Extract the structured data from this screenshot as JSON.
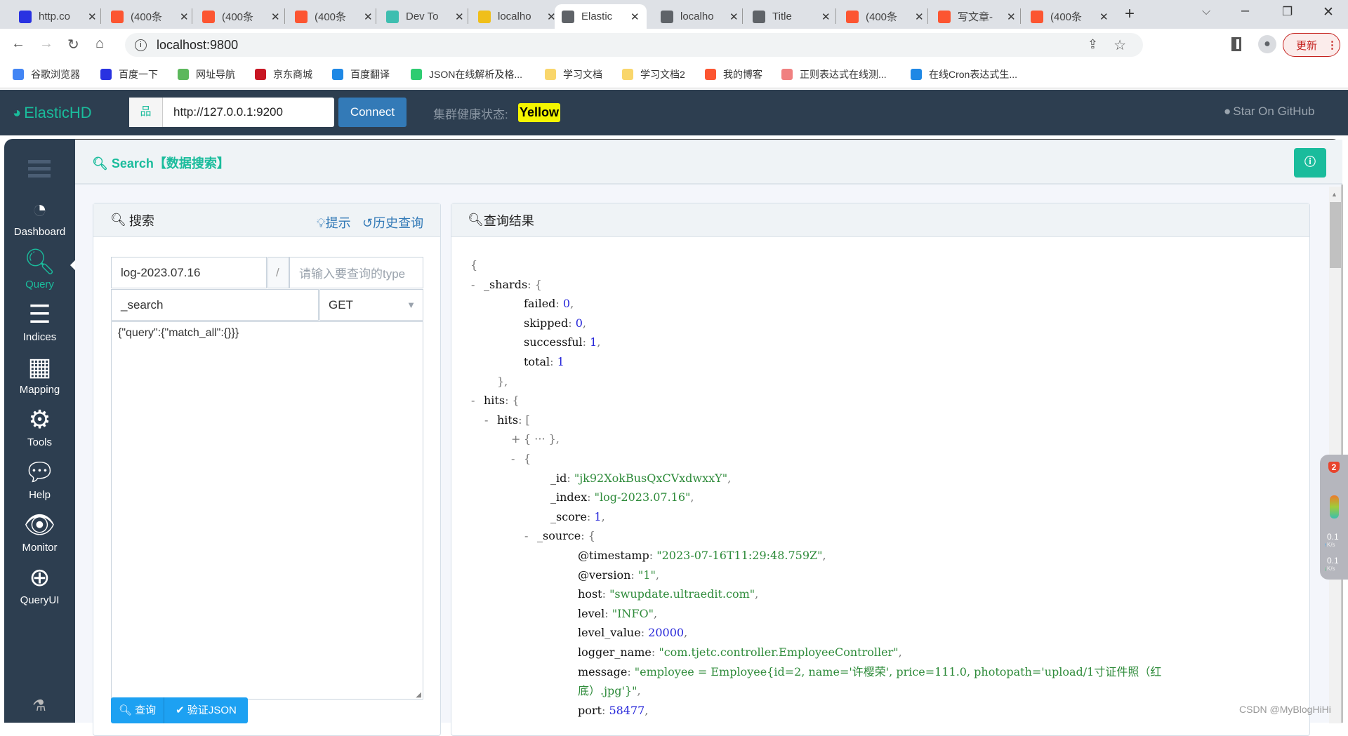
{
  "browser": {
    "tabs": [
      {
        "title": "http.co",
        "icon": "baidu-icon",
        "color": "#2932e1"
      },
      {
        "title": "(400条",
        "icon": "csdn-icon",
        "color": "#fc5531"
      },
      {
        "title": "(400条",
        "icon": "csdn-icon",
        "color": "#fc5531"
      },
      {
        "title": "(400条",
        "icon": "csdn-icon",
        "color": "#fc5531"
      },
      {
        "title": "Dev To",
        "icon": "elastic-devtools-icon",
        "color": "#3ebeb0"
      },
      {
        "title": "localho",
        "icon": "elastic-icon",
        "color": "#f0bf1a"
      },
      {
        "title": "Elastic",
        "icon": "globe-icon",
        "color": "#5f6368",
        "active": true
      },
      {
        "title": "localho",
        "icon": "globe-icon",
        "color": "#5f6368"
      },
      {
        "title": "Title",
        "icon": "globe-icon",
        "color": "#5f6368"
      },
      {
        "title": "(400条",
        "icon": "csdn-icon",
        "color": "#fc5531"
      },
      {
        "title": "写文章-",
        "icon": "csdn-icon",
        "color": "#fc5531"
      },
      {
        "title": "(400条",
        "icon": "csdn-icon",
        "color": "#fc5531"
      }
    ],
    "url": "localhost:9800",
    "update_label": "更新",
    "bookmarks": [
      {
        "label": "谷歌浏览器",
        "color": "#4285f4"
      },
      {
        "label": "百度一下",
        "color": "#2932e1"
      },
      {
        "label": "网址导航",
        "color": "#5cb85c"
      },
      {
        "label": "京东商城",
        "color": "#c81623"
      },
      {
        "label": "百度翻译",
        "color": "#1e88e5"
      },
      {
        "label": "JSON在线解析及格...",
        "color": "#2ecc71"
      },
      {
        "label": "学习文档",
        "color": "#f9d66b"
      },
      {
        "label": "学习文档2",
        "color": "#f9d66b"
      },
      {
        "label": "我的博客",
        "color": "#fc5531"
      },
      {
        "label": "正则表达式在线测...",
        "color": "#f08080"
      },
      {
        "label": "在线Cron表达式生...",
        "color": "#1e88e5"
      }
    ]
  },
  "app": {
    "brand": "ElasticHD",
    "server_url": "http://127.0.0.1:9200",
    "connect_label": "Connect",
    "health_label": "集群健康状态:",
    "health_value": "Yellow",
    "health_color": "#f5f500",
    "github_label": "Star On GitHub",
    "accent": "#1abc9c"
  },
  "sidebar": {
    "items": [
      {
        "label": "Dashboard",
        "icon": "dashboard-icon"
      },
      {
        "label": "Query",
        "icon": "search-icon",
        "active": true
      },
      {
        "label": "Indices",
        "icon": "list-icon"
      },
      {
        "label": "Mapping",
        "icon": "table-icon"
      },
      {
        "label": "Tools",
        "icon": "gears-icon"
      },
      {
        "label": "Help",
        "icon": "chat-icon"
      },
      {
        "label": "Monitor",
        "icon": "eye-icon"
      },
      {
        "label": "QueryUI",
        "icon": "zoom-in-icon"
      }
    ]
  },
  "page": {
    "title": "Search【数据搜索】"
  },
  "search_panel": {
    "title": "搜索",
    "hint_label": "提示",
    "history_label": "历史查询",
    "index_value": "log-2023.07.16",
    "separator": "/",
    "type_placeholder": "请输入要查询的type",
    "endpoint_value": "_search",
    "method_value": "GET",
    "body_value": "{\"query\":{\"match_all\":{}}}",
    "query_button": "查询",
    "validate_button": "验证JSON"
  },
  "result_panel": {
    "title": "查询结果",
    "lines": [
      {
        "level": 0,
        "open": "{"
      },
      {
        "level": 1,
        "toggle": "-",
        "key": "_shards",
        "open": "{"
      },
      {
        "level": 3,
        "key": "failed",
        "value": "0",
        "type": "n",
        "tail": ","
      },
      {
        "level": 3,
        "key": "skipped",
        "value": "0",
        "type": "n",
        "tail": ","
      },
      {
        "level": 3,
        "key": "successful",
        "value": "1",
        "type": "n",
        "tail": ","
      },
      {
        "level": 3,
        "key": "total",
        "value": "1",
        "type": "n"
      },
      {
        "level": 2,
        "open": "},"
      },
      {
        "level": 1,
        "toggle": "-",
        "key": "hits",
        "open": "{"
      },
      {
        "level": 2,
        "toggle": "-",
        "key": "hits",
        "open": "["
      },
      {
        "level": 3,
        "toggle": "+",
        "open": "{ ··· },"
      },
      {
        "level": 3,
        "toggle": "-",
        "open": "{"
      },
      {
        "level": 5,
        "key": "_id",
        "value": "\"jk92XokBusQxCVxdwxxY\"",
        "type": "s",
        "tail": ","
      },
      {
        "level": 5,
        "key": "_index",
        "value": "\"log-2023.07.16\"",
        "type": "s",
        "tail": ","
      },
      {
        "level": 5,
        "key": "_score",
        "value": "1",
        "type": "n",
        "tail": ","
      },
      {
        "level": 4,
        "toggle": "-",
        "key": "_source",
        "open": "{"
      },
      {
        "level": 6,
        "key": "@timestamp",
        "value": "\"2023-07-16T11:29:48.759Z\"",
        "type": "s",
        "tail": ","
      },
      {
        "level": 6,
        "key": "@version",
        "value": "\"1\"",
        "type": "s",
        "tail": ","
      },
      {
        "level": 6,
        "key": "host",
        "value": "\"swupdate.ultraedit.com\"",
        "type": "s",
        "tail": ","
      },
      {
        "level": 6,
        "key": "level",
        "value": "\"INFO\"",
        "type": "s",
        "tail": ","
      },
      {
        "level": 6,
        "key": "level_value",
        "value": "20000",
        "type": "n",
        "tail": ","
      },
      {
        "level": 6,
        "key": "logger_name",
        "value": "\"com.tjetc.controller.EmployeeController\"",
        "type": "s",
        "tail": ","
      },
      {
        "level": 6,
        "key": "message",
        "value": "\"employee = Employee{id=2, name='许樱荣', price=111.0, photopath='upload/1寸证件照（红",
        "type": "s"
      },
      {
        "level": 6,
        "value": "底）.jpg'}\"",
        "type": "s",
        "tail": ","
      },
      {
        "level": 6,
        "key": "port",
        "value": "58477",
        "type": "n",
        "tail": ","
      }
    ]
  },
  "widget": {
    "badge": "2",
    "up_speed": "0.1",
    "down_speed": "0.1",
    "unit": "K/s"
  },
  "watermark": "CSDN @MyBlogHiHi"
}
